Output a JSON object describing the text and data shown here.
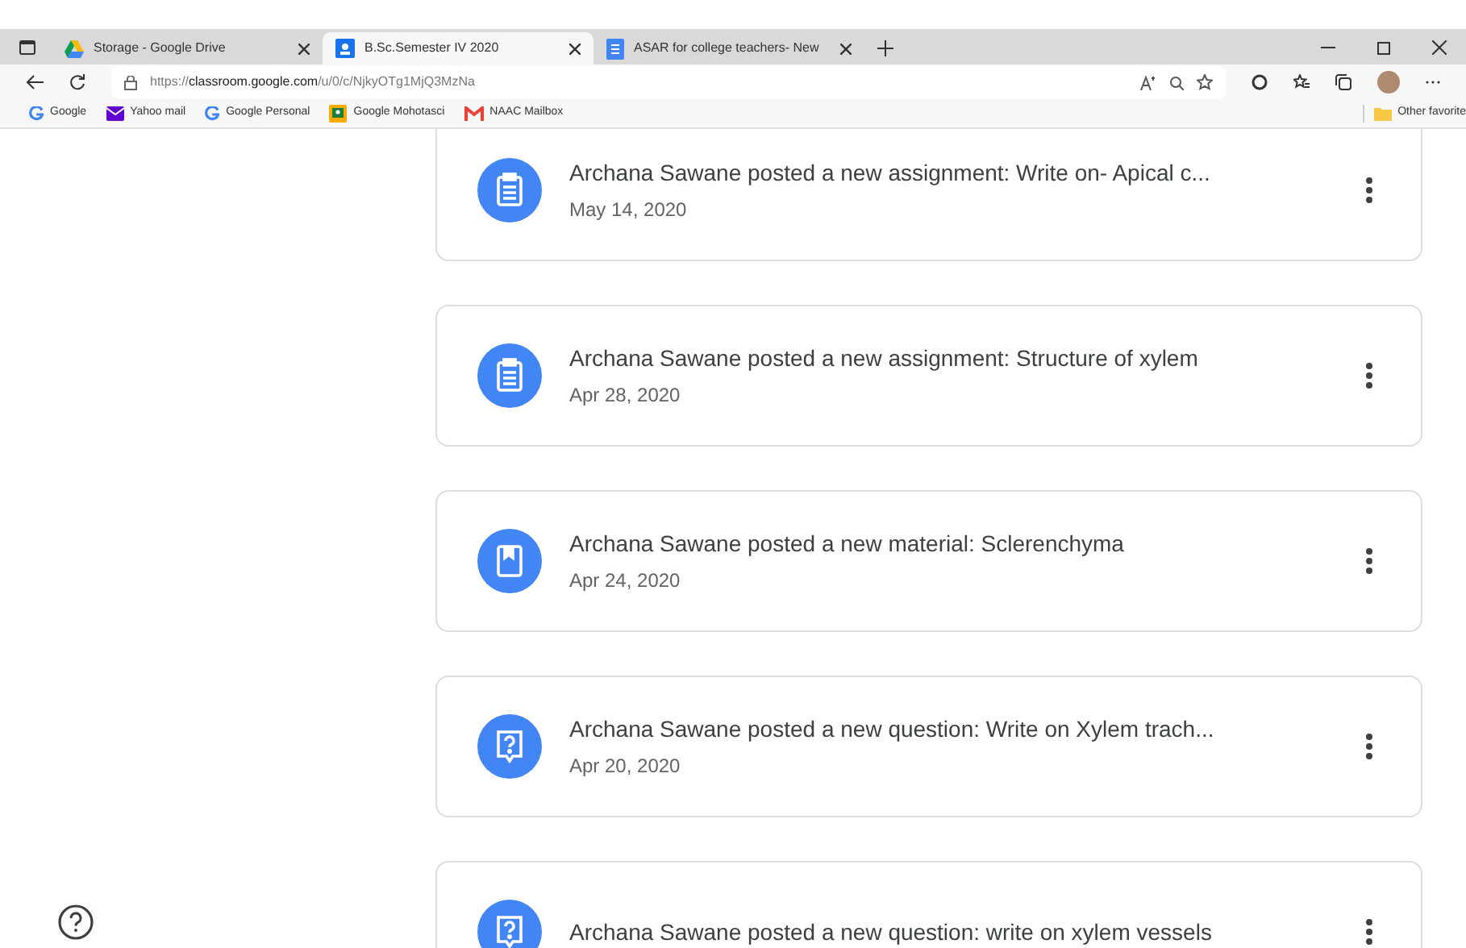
{
  "browser": {
    "tabs": [
      {
        "title": "Storage - Google Drive",
        "kind": "drive",
        "selected": false
      },
      {
        "title": "B.Sc.Semester IV 2020",
        "kind": "classroom",
        "selected": true
      },
      {
        "title": "ASAR for college teachers- New",
        "kind": "docs",
        "selected": false
      }
    ],
    "address": {
      "prefix": "https://",
      "host": "classroom.google.com",
      "path": "/u/0/c/NjkyOTg1MjQ3MzNa"
    },
    "bookmarks": [
      {
        "label": "Google",
        "kind": "google"
      },
      {
        "label": "Yahoo mail",
        "kind": "mail"
      },
      {
        "label": "Google Personal",
        "kind": "google"
      },
      {
        "label": "Google Mohotasci",
        "kind": "classroom"
      },
      {
        "label": "NAAC Mailbox",
        "kind": "gmail"
      }
    ],
    "other_favorites": "Other favorite"
  },
  "stream": [
    {
      "kind": "assignment",
      "title": "Archana Sawane posted a new assignment: Write on- Apical c...",
      "date": "May 14, 2020"
    },
    {
      "kind": "assignment",
      "title": "Archana Sawane posted a new assignment: Structure of xylem",
      "date": "Apr 28, 2020"
    },
    {
      "kind": "material",
      "title": "Archana Sawane posted a new material: Sclerenchyma",
      "date": "Apr 24, 2020"
    },
    {
      "kind": "question",
      "title": "Archana Sawane posted a new question: Write on Xylem trach...",
      "date": "Apr 20, 2020"
    },
    {
      "kind": "question",
      "title": "Archana Sawane posted a new question: write on xylem vessels"
    }
  ]
}
